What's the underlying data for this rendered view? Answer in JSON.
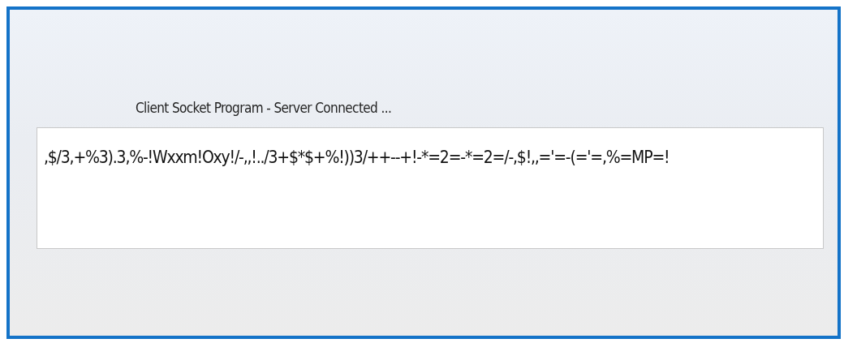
{
  "status_label": "Client Socket Program - Server Connected ...",
  "message_box": {
    "value": ",$/3,+%3).3,%-!Wxxm!Oxy!/-,,!../3+$*$+%!))3/++--+!-*=2=-*=2=/-,$!,,='=-(='=,%=MP=!"
  }
}
